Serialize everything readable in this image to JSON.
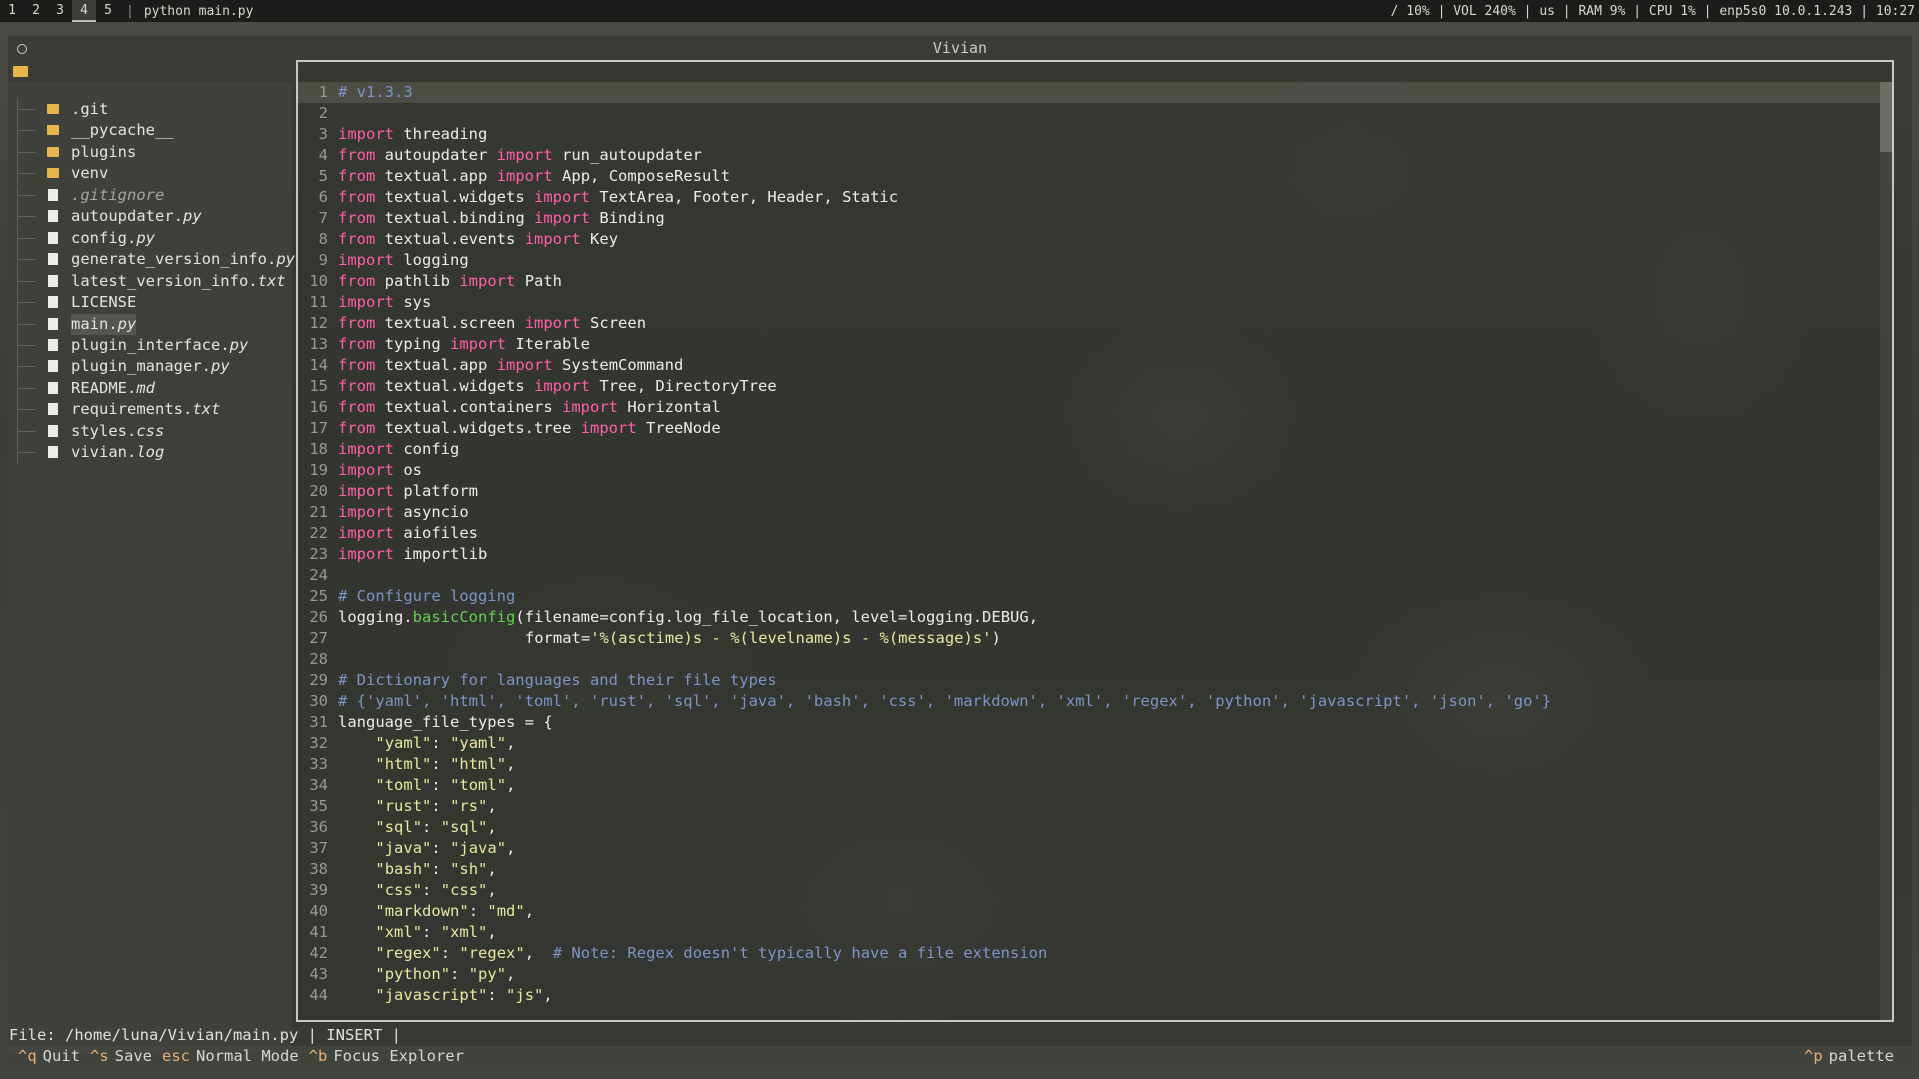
{
  "topbar": {
    "workspaces": [
      "1",
      "2",
      "3",
      "4",
      "5"
    ],
    "active_workspace": "4",
    "window_title": "python main.py",
    "status": "/ 10% | VOL 240% | us | RAM  9% | CPU  1% | enp5s0 10.0.1.243 | 10:27"
  },
  "window": {
    "title": "Vivian"
  },
  "explorer": {
    "items": [
      {
        "name": ".git",
        "type": "folder"
      },
      {
        "name": "__pycache__",
        "type": "folder"
      },
      {
        "name": "plugins",
        "type": "folder"
      },
      {
        "name": "venv",
        "type": "folder"
      },
      {
        "name": ".gitignore",
        "type": "file"
      },
      {
        "name": "autoupdater.py",
        "type": "file"
      },
      {
        "name": "config.py",
        "type": "file"
      },
      {
        "name": "generate_version_info.py",
        "type": "file"
      },
      {
        "name": "latest_version_info.txt",
        "type": "file"
      },
      {
        "name": "LICENSE",
        "type": "file"
      },
      {
        "name": "main.py",
        "type": "file",
        "selected": true
      },
      {
        "name": "plugin_interface.py",
        "type": "file"
      },
      {
        "name": "plugin_manager.py",
        "type": "file"
      },
      {
        "name": "README.md",
        "type": "file"
      },
      {
        "name": "requirements.txt",
        "type": "file"
      },
      {
        "name": "styles.css",
        "type": "file"
      },
      {
        "name": "vivian.log",
        "type": "file"
      }
    ]
  },
  "editor": {
    "lines": [
      "# v1.3.3",
      "",
      "import threading",
      "from autoupdater import run_autoupdater",
      "from textual.app import App, ComposeResult",
      "from textual.widgets import TextArea, Footer, Header, Static",
      "from textual.binding import Binding",
      "from textual.events import Key",
      "import logging",
      "from pathlib import Path",
      "import sys",
      "from textual.screen import Screen",
      "from typing import Iterable",
      "from textual.app import SystemCommand",
      "from textual.widgets import Tree, DirectoryTree",
      "from textual.containers import Horizontal",
      "from textual.widgets.tree import TreeNode",
      "import config",
      "import os",
      "import platform",
      "import asyncio",
      "import aiofiles",
      "import importlib",
      "",
      "# Configure logging",
      "logging.basicConfig(filename=config.log_file_location, level=logging.DEBUG,",
      "                    format='%(asctime)s - %(levelname)s - %(message)s')",
      "",
      "# Dictionary for languages and their file types",
      "# {'yaml', 'html', 'toml', 'rust', 'sql', 'java', 'bash', 'css', 'markdown', 'xml', 'regex', 'python', 'javascript', 'json', 'go'}",
      "language_file_types = {",
      "    \"yaml\": \"yaml\",",
      "    \"html\": \"html\",",
      "    \"toml\": \"toml\",",
      "    \"rust\": \"rs\",",
      "    \"sql\": \"sql\",",
      "    \"java\": \"java\",",
      "    \"bash\": \"sh\",",
      "    \"css\": \"css\",",
      "    \"markdown\": \"md\",",
      "    \"xml\": \"xml\",",
      "    \"regex\": \"regex\",  # Note: Regex doesn't typically have a file extension",
      "    \"python\": \"py\",",
      "    \"javascript\": \"js\","
    ]
  },
  "statusline": "File: /home/luna/Vivian/main.py | INSERT |",
  "footer": {
    "bindings": [
      {
        "key": "^q",
        "label": "Quit"
      },
      {
        "key": "^s",
        "label": "Save"
      },
      {
        "key": "esc",
        "label": "Normal Mode"
      },
      {
        "key": "^b",
        "label": "Focus Explorer"
      }
    ],
    "palette": {
      "key": "^p",
      "label": "palette"
    }
  },
  "colors": {
    "comment": "#7f93c8",
    "keyword": "#ff5fa8",
    "function": "#62d050",
    "string": "#e8e8a0",
    "folder": "#e6b64c"
  },
  "icons": {
    "folder": "folder-icon",
    "file": "file-icon"
  }
}
